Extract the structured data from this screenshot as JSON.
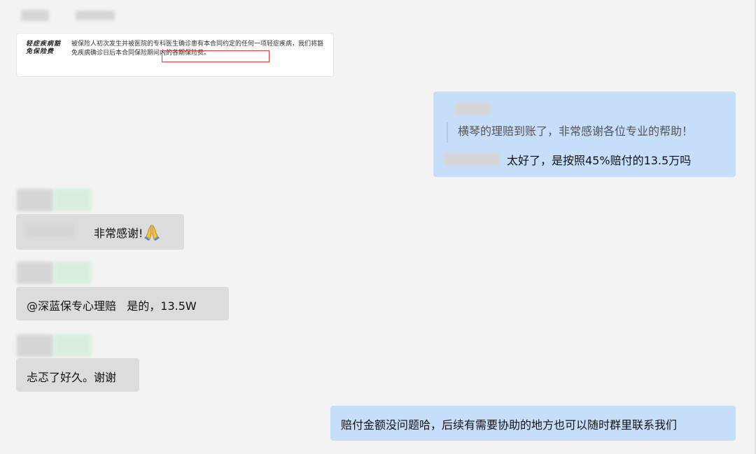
{
  "document_card": {
    "term": "轻症疾病豁免保险费",
    "text_before_highlight": "被保险人初次发生并被医院的专科医生确诊患有本合同约定的任何一项轻症疾病，我们将豁免疾病确诊日后",
    "highlighted_text": "本合同保险期间内的各期保险费。"
  },
  "messages": [
    {
      "side": "right",
      "quote": "横琴的理赔到账了，非常感谢各位专业的帮助！",
      "text": "太好了，是按照45%赔付的13.5万吗"
    },
    {
      "side": "left",
      "text": "非常感谢!",
      "emoji": "folded-hands-icon"
    },
    {
      "side": "left",
      "text": "@深蓝保专心理赔   是的，13.5W"
    },
    {
      "side": "left",
      "text": "忐忑了好久。谢谢"
    },
    {
      "side": "right",
      "text": "赔付金额没问题哈，后续有需要协助的地方也可以随时群里联系我们"
    }
  ],
  "colors": {
    "background": "#f3f3f3",
    "left_bubble": "#dcdcdc",
    "right_bubble": "#c6defa",
    "highlight_border": "#e03a3a"
  }
}
